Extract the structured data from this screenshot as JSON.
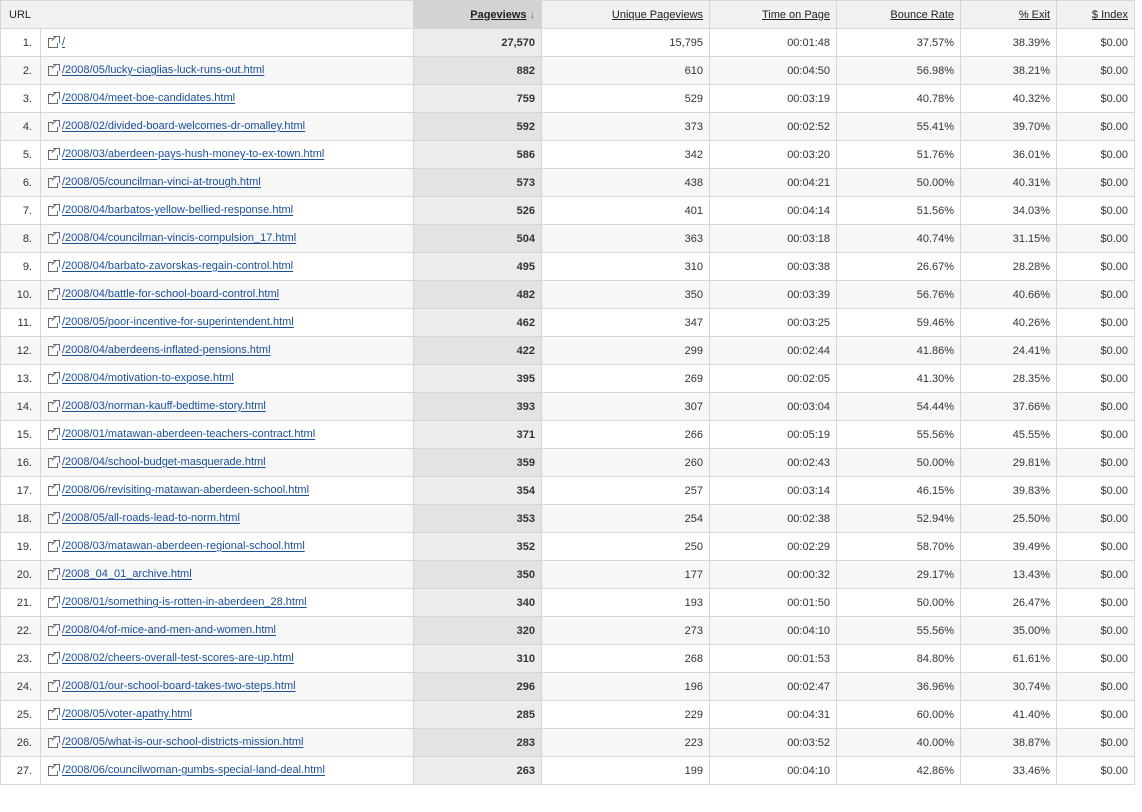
{
  "columns": {
    "url": "URL",
    "pageviews": "Pageviews",
    "unique": "Unique Pageviews",
    "time": "Time on Page",
    "bounce": "Bounce Rate",
    "exit": "% Exit",
    "index": "$ Index"
  },
  "sort_arrow": "↓",
  "rows": [
    {
      "n": "1.",
      "url": "/",
      "pv": "27,570",
      "upv": "15,795",
      "top": "00:01:48",
      "br": "37.57%",
      "exit": "38.39%",
      "idx": "$0.00"
    },
    {
      "n": "2.",
      "url": "/2008/05/lucky-ciaglias-luck-runs-out.html",
      "pv": "882",
      "upv": "610",
      "top": "00:04:50",
      "br": "56.98%",
      "exit": "38.21%",
      "idx": "$0.00"
    },
    {
      "n": "3.",
      "url": "/2008/04/meet-boe-candidates.html",
      "pv": "759",
      "upv": "529",
      "top": "00:03:19",
      "br": "40.78%",
      "exit": "40.32%",
      "idx": "$0.00"
    },
    {
      "n": "4.",
      "url": "/2008/02/divided-board-welcomes-dr-omalley.html",
      "pv": "592",
      "upv": "373",
      "top": "00:02:52",
      "br": "55.41%",
      "exit": "39.70%",
      "idx": "$0.00"
    },
    {
      "n": "5.",
      "url": "/2008/03/aberdeen-pays-hush-money-to-ex-town.html",
      "pv": "586",
      "upv": "342",
      "top": "00:03:20",
      "br": "51.76%",
      "exit": "36.01%",
      "idx": "$0.00"
    },
    {
      "n": "6.",
      "url": "/2008/05/councilman-vinci-at-trough.html",
      "pv": "573",
      "upv": "438",
      "top": "00:04:21",
      "br": "50.00%",
      "exit": "40.31%",
      "idx": "$0.00"
    },
    {
      "n": "7.",
      "url": "/2008/04/barbatos-yellow-bellied-response.html",
      "pv": "526",
      "upv": "401",
      "top": "00:04:14",
      "br": "51.56%",
      "exit": "34.03%",
      "idx": "$0.00"
    },
    {
      "n": "8.",
      "url": "/2008/04/councilman-vincis-compulsion_17.html",
      "pv": "504",
      "upv": "363",
      "top": "00:03:18",
      "br": "40.74%",
      "exit": "31.15%",
      "idx": "$0.00"
    },
    {
      "n": "9.",
      "url": "/2008/04/barbato-zavorskas-regain-control.html",
      "pv": "495",
      "upv": "310",
      "top": "00:03:38",
      "br": "26.67%",
      "exit": "28.28%",
      "idx": "$0.00"
    },
    {
      "n": "10.",
      "url": "/2008/04/battle-for-school-board-control.html",
      "pv": "482",
      "upv": "350",
      "top": "00:03:39",
      "br": "56.76%",
      "exit": "40.66%",
      "idx": "$0.00"
    },
    {
      "n": "11.",
      "url": "/2008/05/poor-incentive-for-superintendent.html",
      "pv": "462",
      "upv": "347",
      "top": "00:03:25",
      "br": "59.46%",
      "exit": "40.26%",
      "idx": "$0.00"
    },
    {
      "n": "12.",
      "url": "/2008/04/aberdeens-inflated-pensions.html",
      "pv": "422",
      "upv": "299",
      "top": "00:02:44",
      "br": "41.86%",
      "exit": "24.41%",
      "idx": "$0.00"
    },
    {
      "n": "13.",
      "url": "/2008/04/motivation-to-expose.html",
      "pv": "395",
      "upv": "269",
      "top": "00:02:05",
      "br": "41.30%",
      "exit": "28.35%",
      "idx": "$0.00"
    },
    {
      "n": "14.",
      "url": "/2008/03/norman-kauff-bedtime-story.html",
      "pv": "393",
      "upv": "307",
      "top": "00:03:04",
      "br": "54.44%",
      "exit": "37.66%",
      "idx": "$0.00"
    },
    {
      "n": "15.",
      "url": "/2008/01/matawan-aberdeen-teachers-contract.html",
      "pv": "371",
      "upv": "266",
      "top": "00:05:19",
      "br": "55.56%",
      "exit": "45.55%",
      "idx": "$0.00"
    },
    {
      "n": "16.",
      "url": "/2008/04/school-budget-masquerade.html",
      "pv": "359",
      "upv": "260",
      "top": "00:02:43",
      "br": "50.00%",
      "exit": "29.81%",
      "idx": "$0.00"
    },
    {
      "n": "17.",
      "url": "/2008/06/revisiting-matawan-aberdeen-school.html",
      "pv": "354",
      "upv": "257",
      "top": "00:03:14",
      "br": "46.15%",
      "exit": "39.83%",
      "idx": "$0.00"
    },
    {
      "n": "18.",
      "url": "/2008/05/all-roads-lead-to-norm.html",
      "pv": "353",
      "upv": "254",
      "top": "00:02:38",
      "br": "52.94%",
      "exit": "25.50%",
      "idx": "$0.00"
    },
    {
      "n": "19.",
      "url": "/2008/03/matawan-aberdeen-regional-school.html",
      "pv": "352",
      "upv": "250",
      "top": "00:02:29",
      "br": "58.70%",
      "exit": "39.49%",
      "idx": "$0.00"
    },
    {
      "n": "20.",
      "url": "/2008_04_01_archive.html",
      "pv": "350",
      "upv": "177",
      "top": "00:00:32",
      "br": "29.17%",
      "exit": "13.43%",
      "idx": "$0.00"
    },
    {
      "n": "21.",
      "url": "/2008/01/something-is-rotten-in-aberdeen_28.html",
      "pv": "340",
      "upv": "193",
      "top": "00:01:50",
      "br": "50.00%",
      "exit": "26.47%",
      "idx": "$0.00"
    },
    {
      "n": "22.",
      "url": "/2008/04/of-mice-and-men-and-women.html",
      "pv": "320",
      "upv": "273",
      "top": "00:04:10",
      "br": "55.56%",
      "exit": "35.00%",
      "idx": "$0.00"
    },
    {
      "n": "23.",
      "url": "/2008/02/cheers-overall-test-scores-are-up.html",
      "pv": "310",
      "upv": "268",
      "top": "00:01:53",
      "br": "84.80%",
      "exit": "61.61%",
      "idx": "$0.00"
    },
    {
      "n": "24.",
      "url": "/2008/01/our-school-board-takes-two-steps.html",
      "pv": "296",
      "upv": "196",
      "top": "00:02:47",
      "br": "36.96%",
      "exit": "30.74%",
      "idx": "$0.00"
    },
    {
      "n": "25.",
      "url": "/2008/05/voter-apathy.html",
      "pv": "285",
      "upv": "229",
      "top": "00:04:31",
      "br": "60.00%",
      "exit": "41.40%",
      "idx": "$0.00"
    },
    {
      "n": "26.",
      "url": "/2008/05/what-is-our-school-districts-mission.html",
      "pv": "283",
      "upv": "223",
      "top": "00:03:52",
      "br": "40.00%",
      "exit": "38.87%",
      "idx": "$0.00"
    },
    {
      "n": "27.",
      "url": "/2008/06/councilwoman-gumbs-special-land-deal.html",
      "pv": "263",
      "upv": "199",
      "top": "00:04:10",
      "br": "42.86%",
      "exit": "33.46%",
      "idx": "$0.00"
    }
  ]
}
